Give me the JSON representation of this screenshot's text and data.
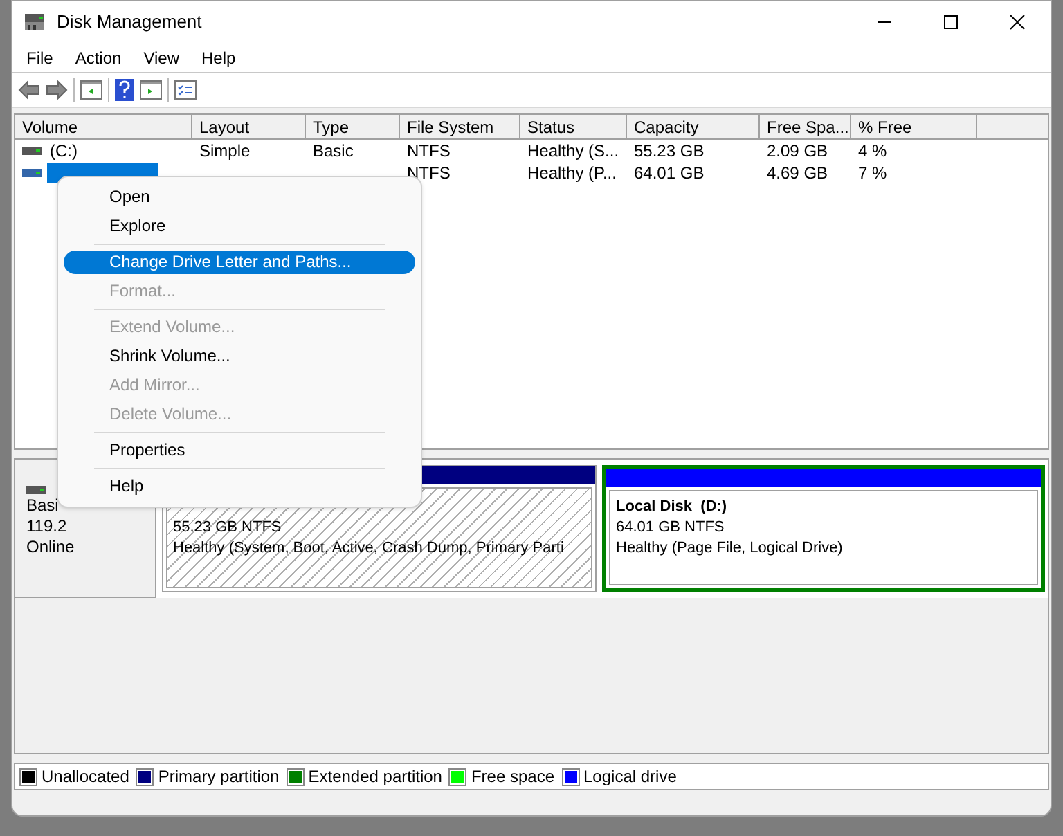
{
  "window": {
    "title": "Disk Management"
  },
  "menu_bar": [
    "File",
    "Action",
    "View",
    "Help"
  ],
  "volume_list": {
    "columns": [
      "Volume",
      "Layout",
      "Type",
      "File System",
      "Status",
      "Capacity",
      "Free Spa...",
      "% Free"
    ],
    "rows": [
      {
        "selected": false,
        "cells": [
          "(C:)",
          "Simple",
          "Basic",
          "NTFS",
          "Healthy (S...",
          "55.23 GB",
          "2.09 GB",
          "4 %"
        ]
      },
      {
        "selected": true,
        "cells": [
          null,
          null,
          null,
          "NTFS",
          "Healthy (P...",
          "64.01 GB",
          "4.69 GB",
          "7 %"
        ]
      }
    ]
  },
  "context_menu": [
    {
      "label": "Open",
      "disabled": false,
      "selected": false
    },
    {
      "label": "Explore",
      "disabled": false,
      "selected": false
    },
    {
      "kind": "separator"
    },
    {
      "label": "Change Drive Letter and Paths...",
      "disabled": false,
      "selected": true
    },
    {
      "label": "Format...",
      "disabled": true,
      "selected": false
    },
    {
      "kind": "separator"
    },
    {
      "label": "Extend Volume...",
      "disabled": true,
      "selected": false
    },
    {
      "label": "Shrink Volume...",
      "disabled": false,
      "selected": false
    },
    {
      "label": "Add Mirror...",
      "disabled": true,
      "selected": false
    },
    {
      "label": "Delete Volume...",
      "disabled": true,
      "selected": false
    },
    {
      "kind": "separator"
    },
    {
      "label": "Properties",
      "disabled": false,
      "selected": false
    },
    {
      "kind": "separator"
    },
    {
      "label": "Help",
      "disabled": false,
      "selected": false
    }
  ],
  "disk": {
    "type": "Basi",
    "size": "119.2",
    "state": "Online",
    "partitions": [
      {
        "color": "#000080",
        "size": "55.23 GB NTFS",
        "status": "Healthy (System, Boot, Active, Crash Dump, Primary Parti",
        "hatched": true,
        "selected": false
      },
      {
        "color": "#0000ff",
        "name": "Local Disk  (D:)",
        "size": "64.01 GB NTFS",
        "status": "Healthy (Page File, Logical Drive)",
        "hatched": false,
        "selected": true
      }
    ]
  },
  "legend": [
    {
      "label": "Unallocated",
      "color": "#000000"
    },
    {
      "label": "Primary partition",
      "color": "#000080"
    },
    {
      "label": "Extended partition",
      "color": "#008000"
    },
    {
      "label": "Free space",
      "color": "#00ff00"
    },
    {
      "label": "Logical drive",
      "color": "#0000ff"
    }
  ]
}
